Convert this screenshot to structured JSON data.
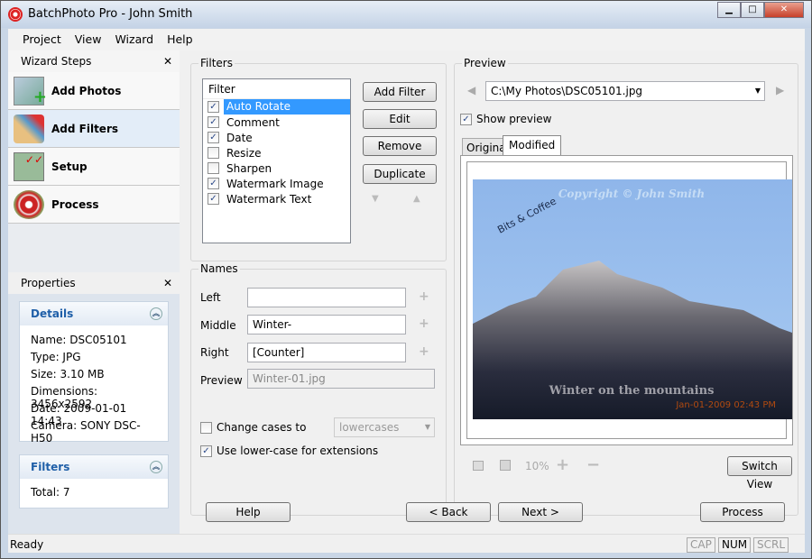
{
  "window": {
    "title": "BatchPhoto Pro - John Smith"
  },
  "menu": [
    "Project",
    "View",
    "Wizard",
    "Help"
  ],
  "wizard": {
    "title": "Wizard Steps",
    "steps": [
      "Add Photos",
      "Add Filters",
      "Setup",
      "Process"
    ]
  },
  "properties": {
    "title": "Properties",
    "details_title": "Details",
    "details": [
      "Name: DSC05101",
      "Type: JPG",
      "Size: 3.10 MB",
      "Dimensions: 3456x2592",
      "Date: 2009-01-01 14:43",
      "Camera: SONY DSC-H50"
    ],
    "filters_title": "Filters",
    "filters_total": "Total: 7"
  },
  "filters": {
    "title": "Filters",
    "header": "Filter",
    "items": [
      {
        "label": "Auto Rotate",
        "checked": true
      },
      {
        "label": "Comment",
        "checked": true
      },
      {
        "label": "Date",
        "checked": true
      },
      {
        "label": "Resize",
        "checked": false
      },
      {
        "label": "Sharpen",
        "checked": false
      },
      {
        "label": "Watermark Image",
        "checked": true
      },
      {
        "label": "Watermark Text",
        "checked": true
      }
    ],
    "add": "Add Filter",
    "edit": "Edit",
    "remove": "Remove",
    "duplicate": "Duplicate"
  },
  "names": {
    "title": "Names",
    "left_label": "Left",
    "left": "",
    "middle_label": "Middle",
    "middle": "Winter-",
    "right_label": "Right",
    "right": "[Counter]",
    "preview_label": "Preview",
    "preview": "Winter-01.jpg",
    "change_cases": "Change cases to",
    "case_value": "lowercases",
    "lower_ext": "Use lower-case for extensions"
  },
  "preview": {
    "title": "Preview",
    "path": "C:\\My Photos\\DSC05101.jpg",
    "show": "Show preview",
    "tabs": [
      "Original",
      "Modified"
    ],
    "copyright": "Copyright © John Smith",
    "logo": "Bits & Coffee",
    "caption": "Winter on the mountains",
    "date": "Jan-01-2009 02:43 PM",
    "zoom": "10%",
    "switch": "Switch View"
  },
  "nav": {
    "help": "Help",
    "back": "< Back",
    "next": "Next >",
    "process": "Process"
  },
  "status": {
    "text": "Ready",
    "cap": "CAP",
    "num": "NUM",
    "scrl": "SCRL"
  }
}
